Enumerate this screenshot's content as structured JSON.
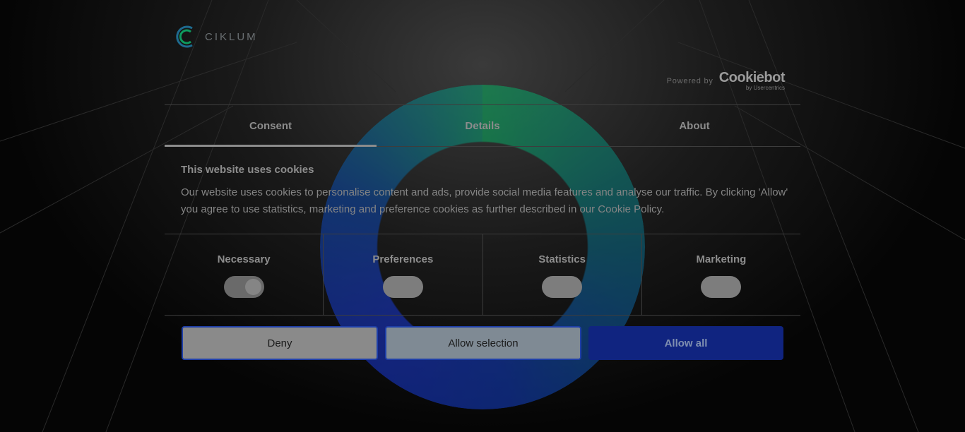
{
  "brand": {
    "logo_text": "CIKLUM"
  },
  "powered_by": {
    "label": "Powered by",
    "brand": "Cookiebot",
    "sub": "by Usercentrics"
  },
  "tabs": [
    {
      "label": "Consent",
      "active": true
    },
    {
      "label": "Details",
      "active": false
    },
    {
      "label": "About",
      "active": false
    }
  ],
  "consent": {
    "heading": "This website uses cookies",
    "body": "Our website uses cookies to personalise content and ads, provide social media features and analyse our traffic. By clicking 'Allow' you agree to use statistics, marketing and preference cookies as further described in our Cookie Policy."
  },
  "categories": [
    {
      "label": "Necessary",
      "enabled": true
    },
    {
      "label": "Preferences",
      "enabled": false
    },
    {
      "label": "Statistics",
      "enabled": false
    },
    {
      "label": "Marketing",
      "enabled": false
    }
  ],
  "buttons": {
    "deny": "Deny",
    "allow_selection": "Allow selection",
    "allow_all": "Allow all"
  },
  "colors": {
    "accent": "#1f3fa8",
    "allow_all_bg": "#102480"
  }
}
